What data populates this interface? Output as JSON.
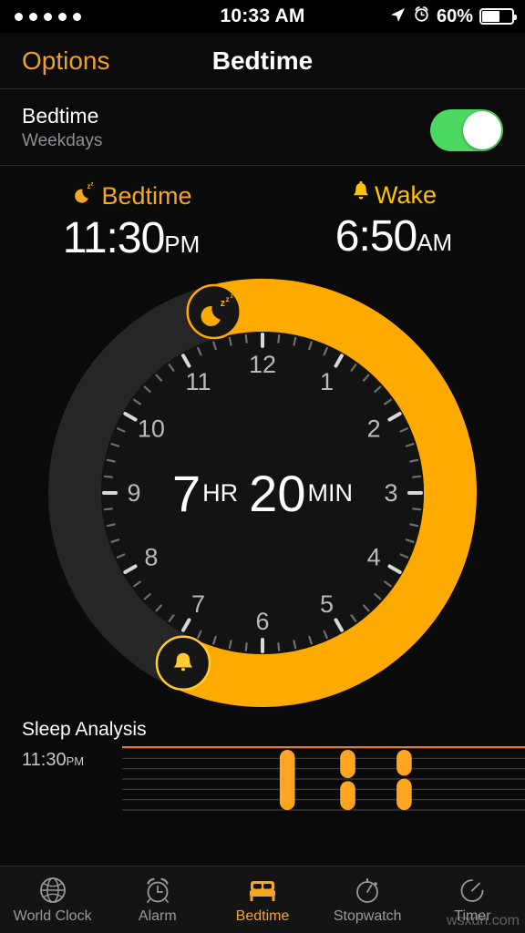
{
  "status_bar": {
    "signal_dots": 5,
    "time": "10:33 AM",
    "battery_percent": "60%",
    "battery_level": 60,
    "icons": [
      "location-arrow-icon",
      "alarm-clock-icon",
      "battery-icon"
    ]
  },
  "nav": {
    "left_button": "Options",
    "title": "Bedtime"
  },
  "toggle_row": {
    "title": "Bedtime",
    "subtitle": "Weekdays",
    "enabled": true,
    "on_color": "#4CD662"
  },
  "schedule": {
    "bedtime": {
      "label": "Bedtime",
      "icon": "moon-zzz-icon",
      "time": "11:30",
      "period": "PM",
      "color": "#F5A623"
    },
    "wake": {
      "label": "Wake",
      "icon": "bell-icon",
      "time": "6:50",
      "period": "AM",
      "color": "#FFC400"
    }
  },
  "dial": {
    "duration_hours": "7",
    "duration_hours_unit": "HR",
    "duration_minutes": "20",
    "duration_minutes_unit": "MIN",
    "hour_numbers": [
      "12",
      "1",
      "2",
      "3",
      "4",
      "5",
      "6",
      "7",
      "8",
      "9",
      "10",
      "11"
    ],
    "bedtime_angle_hour": 11.5,
    "wake_angle_hour": 6.833,
    "arc_color": "#FFAA00",
    "track_color": "#262626",
    "face_color": "#131313",
    "bedtime_handle_icon": "moon-zzz-icon",
    "wake_handle_icon": "bell-icon"
  },
  "sleep_analysis": {
    "title": "Sleep Analysis",
    "start_label": "11:30",
    "start_period": "PM",
    "line_color": "#E8801A",
    "bar_color": "#FFA51F",
    "gridlines": 7
  },
  "chart_data": {
    "type": "bar",
    "title": "Sleep Analysis",
    "xlabel": "",
    "ylabel": "",
    "categories": [
      "bar-1",
      "bar-2",
      "bar-3"
    ],
    "values": [
      100,
      100,
      100
    ],
    "series": [
      {
        "name": "sleep-segments",
        "x_percent": 41,
        "segments": [
          {
            "top": 0,
            "bottom": 100
          }
        ]
      },
      {
        "name": "sleep-segments",
        "x_percent": 56,
        "segments": [
          {
            "top": 0,
            "bottom": 47
          },
          {
            "top": 52,
            "bottom": 100
          }
        ]
      },
      {
        "name": "sleep-segments",
        "x_percent": 70,
        "segments": [
          {
            "top": 0,
            "bottom": 43
          },
          {
            "top": 48,
            "bottom": 100
          }
        ]
      }
    ],
    "ylim": [
      0,
      100
    ],
    "grid": true,
    "legend": "none"
  },
  "tabbar": {
    "items": [
      {
        "label": "World Clock",
        "icon": "globe-icon",
        "active": false
      },
      {
        "label": "Alarm",
        "icon": "alarm-clock-icon",
        "active": false
      },
      {
        "label": "Bedtime",
        "icon": "bed-icon",
        "active": true
      },
      {
        "label": "Stopwatch",
        "icon": "stopwatch-icon",
        "active": false
      },
      {
        "label": "Timer",
        "icon": "timer-icon",
        "active": false
      }
    ],
    "active_color": "#F5A623"
  },
  "watermark": "wsxdn.com"
}
